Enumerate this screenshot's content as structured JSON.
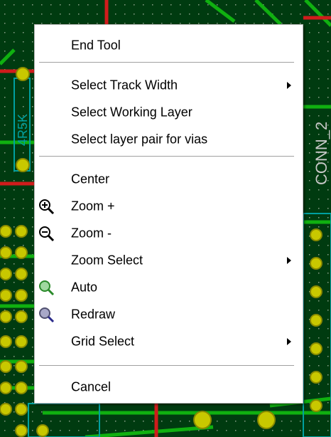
{
  "menu": {
    "end_tool": "End Tool",
    "select_track_width": "Select Track Width",
    "select_working_layer": "Select Working Layer",
    "select_layer_pair": "Select layer pair for vias",
    "center": "Center",
    "zoom_in": "Zoom +",
    "zoom_out": "Zoom -",
    "zoom_select": "Zoom Select",
    "auto": "Auto",
    "redraw": "Redraw",
    "grid_select": "Grid Select",
    "cancel": "Cancel"
  },
  "board": {
    "component_ref": "4R5K",
    "connector_label": "CONN_2"
  },
  "colors": {
    "board_bg": "#003b10",
    "track_green": "#10b010",
    "track_red": "#d01c1c",
    "pad_yellow": "#c8c800",
    "silk_cyan": "#00a0a0"
  },
  "icons": [
    "zoom-in-icon",
    "zoom-out-icon",
    "zoom-auto-icon",
    "redraw-icon",
    "submenu-arrow-icon"
  ]
}
